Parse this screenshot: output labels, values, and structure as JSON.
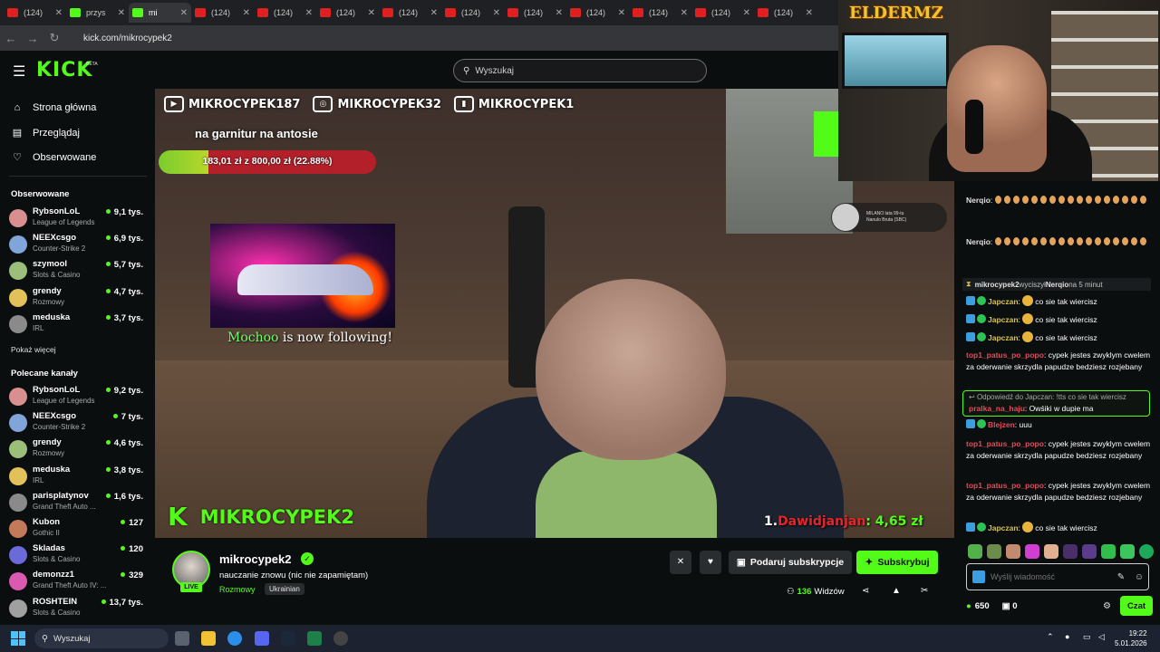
{
  "browser": {
    "tabs": [
      {
        "label": "(124)",
        "kind": "yt"
      },
      {
        "label": "przys",
        "kind": "kick"
      },
      {
        "label": "mi",
        "kind": "kick",
        "active": true
      },
      {
        "label": "(124)",
        "kind": "yt"
      },
      {
        "label": "(124)",
        "kind": "yt"
      },
      {
        "label": "(124)",
        "kind": "yt"
      },
      {
        "label": "(124)",
        "kind": "yt"
      },
      {
        "label": "(124)",
        "kind": "yt"
      },
      {
        "label": "(124)",
        "kind": "yt"
      },
      {
        "label": "(124)",
        "kind": "yt"
      },
      {
        "label": "(124)",
        "kind": "yt"
      },
      {
        "label": "(124)",
        "kind": "yt"
      },
      {
        "label": "(124)",
        "kind": "yt"
      }
    ],
    "url": "kick.com/mikrocypek2"
  },
  "header": {
    "logo": "KICK",
    "logo_badge": "BETA",
    "search_placeholder": "Wyszukaj"
  },
  "sidebar": {
    "nav": [
      {
        "label": "Strona główna",
        "icon": "home-icon"
      },
      {
        "label": "Przeglądaj",
        "icon": "browse-icon"
      },
      {
        "label": "Obserwowane",
        "icon": "heart-icon"
      }
    ],
    "following_title": "Obserwowane",
    "following": [
      {
        "name": "RybsonLoL",
        "category": "League of Legends",
        "viewers": "9,1 tys."
      },
      {
        "name": "NEEXcsgo",
        "category": "Counter-Strike 2",
        "viewers": "6,9 tys."
      },
      {
        "name": "szymool",
        "category": "Slots & Casino",
        "viewers": "5,7 tys."
      },
      {
        "name": "grendy",
        "category": "Rozmowy",
        "viewers": "4,7 tys."
      },
      {
        "name": "meduska",
        "category": "IRL",
        "viewers": "3,7 tys."
      }
    ],
    "show_more": "Pokaż więcej",
    "recommended_title": "Polecane kanały",
    "recommended": [
      {
        "name": "RybsonLoL",
        "category": "League of Legends",
        "viewers": "9,2 tys."
      },
      {
        "name": "NEEXcsgo",
        "category": "Counter-Strike 2",
        "viewers": "7 tys."
      },
      {
        "name": "grendy",
        "category": "Rozmowy",
        "viewers": "4,6 tys."
      },
      {
        "name": "meduska",
        "category": "IRL",
        "viewers": "3,8 tys."
      },
      {
        "name": "parisplatynov",
        "category": "Grand Theft Auto ...",
        "viewers": "1,6 tys."
      },
      {
        "name": "Kubon",
        "category": "Gothic II",
        "viewers": "127"
      },
      {
        "name": "Skladas",
        "category": "Slots & Casino",
        "viewers": "120"
      },
      {
        "name": "demonzz1",
        "category": "Grand Theft Auto IV: ...",
        "viewers": "329"
      },
      {
        "name": "ROSHTEIN",
        "category": "Slots & Casino",
        "viewers": "13,7 tys."
      }
    ]
  },
  "video": {
    "socials": [
      "MIKROCYPEK187",
      "MIKROCYPEK32",
      "MIKROCYPEK1"
    ],
    "goal_title": "na garnitur na antosie",
    "goal_text": "183,01 zł z 800,00 zł (22.88%)",
    "goal_progress": 0.2288,
    "follow_name": "Mochoo",
    "follow_text": " is now following!",
    "brand": "MIKROCYPEK2",
    "brand_k": "K",
    "top_donor_pos": "1.",
    "top_donor_name": "Dawidjanjan",
    "top_donor_amount": ": 4,65 zł",
    "song_line1": "MILANO lata 99-tu",
    "song_line2": "Nanulo Bruta (SBC)"
  },
  "webcam": {
    "logo": "ELDERMZ"
  },
  "chat": {
    "messages": [
      {
        "user": "Nerqio",
        "text": "",
        "eggs": 17,
        "style": "gr"
      },
      {
        "user": "Nerqio",
        "text": "",
        "eggs": 17,
        "style": "gr"
      },
      {
        "user": "Japczan",
        "text": "co sie tak wiercisz",
        "style": "yl",
        "badges": true
      },
      {
        "user": "Japczan",
        "text": "co sie tak wiercisz",
        "style": "yl",
        "badges": true
      },
      {
        "user": "Japczan",
        "text": "co sie tak wiercisz",
        "style": "yl",
        "badges": true
      },
      {
        "user": "top1_patus_po_popo",
        "text": "cypek jestes zwyklym cwelem za oderwanie skrzydla papudze bedziesz rozjebany",
        "style": "rd"
      },
      {
        "user": "Blejzen",
        "text": "uuu",
        "style": "rd",
        "badges": true
      },
      {
        "user": "top1_patus_po_popo",
        "text": "cypek jestes zwyklym cwelem za oderwanie skrzydla papudze bedziesz rozjebany",
        "style": "rd"
      },
      {
        "user": "top1_patus_po_popo",
        "text": "cypek jestes zwyklym cwelem za oderwanie skrzydla papudze bedziesz rozjebany",
        "style": "rd"
      },
      {
        "user": "Japczan",
        "text": "co sie tak wiercisz",
        "style": "yl",
        "badges": true
      }
    ],
    "mod_action": {
      "user": "mikrocypek2",
      "verb": " wyciszył ",
      "target": "Nerqio",
      "suffix": " na 5 minut"
    },
    "reply": {
      "context": "Odpowiedź do Japczan: !tts co sie tak wiercisz",
      "user": "pralka_na_haju",
      "text": ": Owśiki w dupie ma"
    },
    "input_placeholder": "Wyślij wiadomość",
    "points": "650",
    "gifts": "0",
    "chat_button": "Czat"
  },
  "channel": {
    "name": "mikrocypek2",
    "live_label": "LIVE",
    "title": "nauczanie znowu (nic nie zapamiętam)",
    "category": "Rozmowy",
    "language": "Ukrainian",
    "gift_button": "Podaruj subskrypcje",
    "subscribe_button": "Subskrybuj",
    "viewers_count": "136",
    "viewers_label": "Widzów"
  },
  "taskbar": {
    "search": "Wyszukaj",
    "time": "19:22",
    "date": "5.01.2026"
  },
  "colors": {
    "accent": "#53fc18",
    "bg": "#0b0e0f",
    "danger": "#e34b5c"
  }
}
